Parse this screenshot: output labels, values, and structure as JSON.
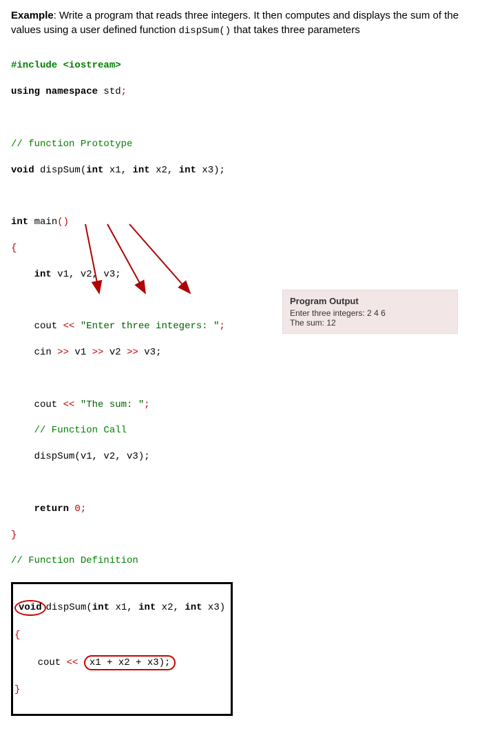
{
  "header": {
    "label": "Example",
    "text": ": Write a program that reads three integers. It then computes and displays the sum of the values using a user defined function ",
    "funcname": "dispSum()",
    "text2": " that takes three parameters"
  },
  "code": {
    "l1a": "#include",
    "l1b": " <iostream>",
    "l2a": "using namespace ",
    "l2b": "std",
    "l2c": ";",
    "l3": "// function Prototype",
    "l4a": "void",
    "l4b": " dispSum(",
    "l4c": "int",
    "l4d": " x1, ",
    "l4e": "int",
    "l4f": " x2, ",
    "l4g": "int",
    "l4h": " x3);",
    "l5a": "int",
    "l5b": " main",
    "l5c": "()",
    "l6": "{",
    "l7a": "    int",
    "l7b": " v1, v2, v3;",
    "l8a": "    cout ",
    "l8b": "<<",
    "l8c": " \"Enter three integers: \"",
    "l8d": ";",
    "l9a": "    cin ",
    "l9b": ">>",
    "l9c": " v1 ",
    "l9d": ">>",
    "l9e": " v2 ",
    "l9f": ">>",
    "l9g": " v3;",
    "l10a": "    cout ",
    "l10b": "<<",
    "l10c": " \"The sum: \"",
    "l10d": ";",
    "l11": "    // Function Call",
    "l12": "    dispSum(v1, v2, v3);",
    "l13a": "    return ",
    "l13b": "0",
    "l13c": ";",
    "l14": "}",
    "l15": "// Function Definition",
    "l16a": "void",
    "l16b": "dispSum(",
    "l16c": "int",
    "l16d": " x1, ",
    "l16e": "int",
    "l16f": " x2, ",
    "l16g": "int",
    "l16h": " x3)",
    "l17": "{",
    "l18a": "    cout ",
    "l18b": "<<",
    "l18c": " ",
    "l18d": "x1 + x2 + x3);",
    "l19": "}"
  },
  "output": {
    "title": "Program Output",
    "line1": "Enter three integers: 2 4 6",
    "line2": "The sum: 12"
  }
}
